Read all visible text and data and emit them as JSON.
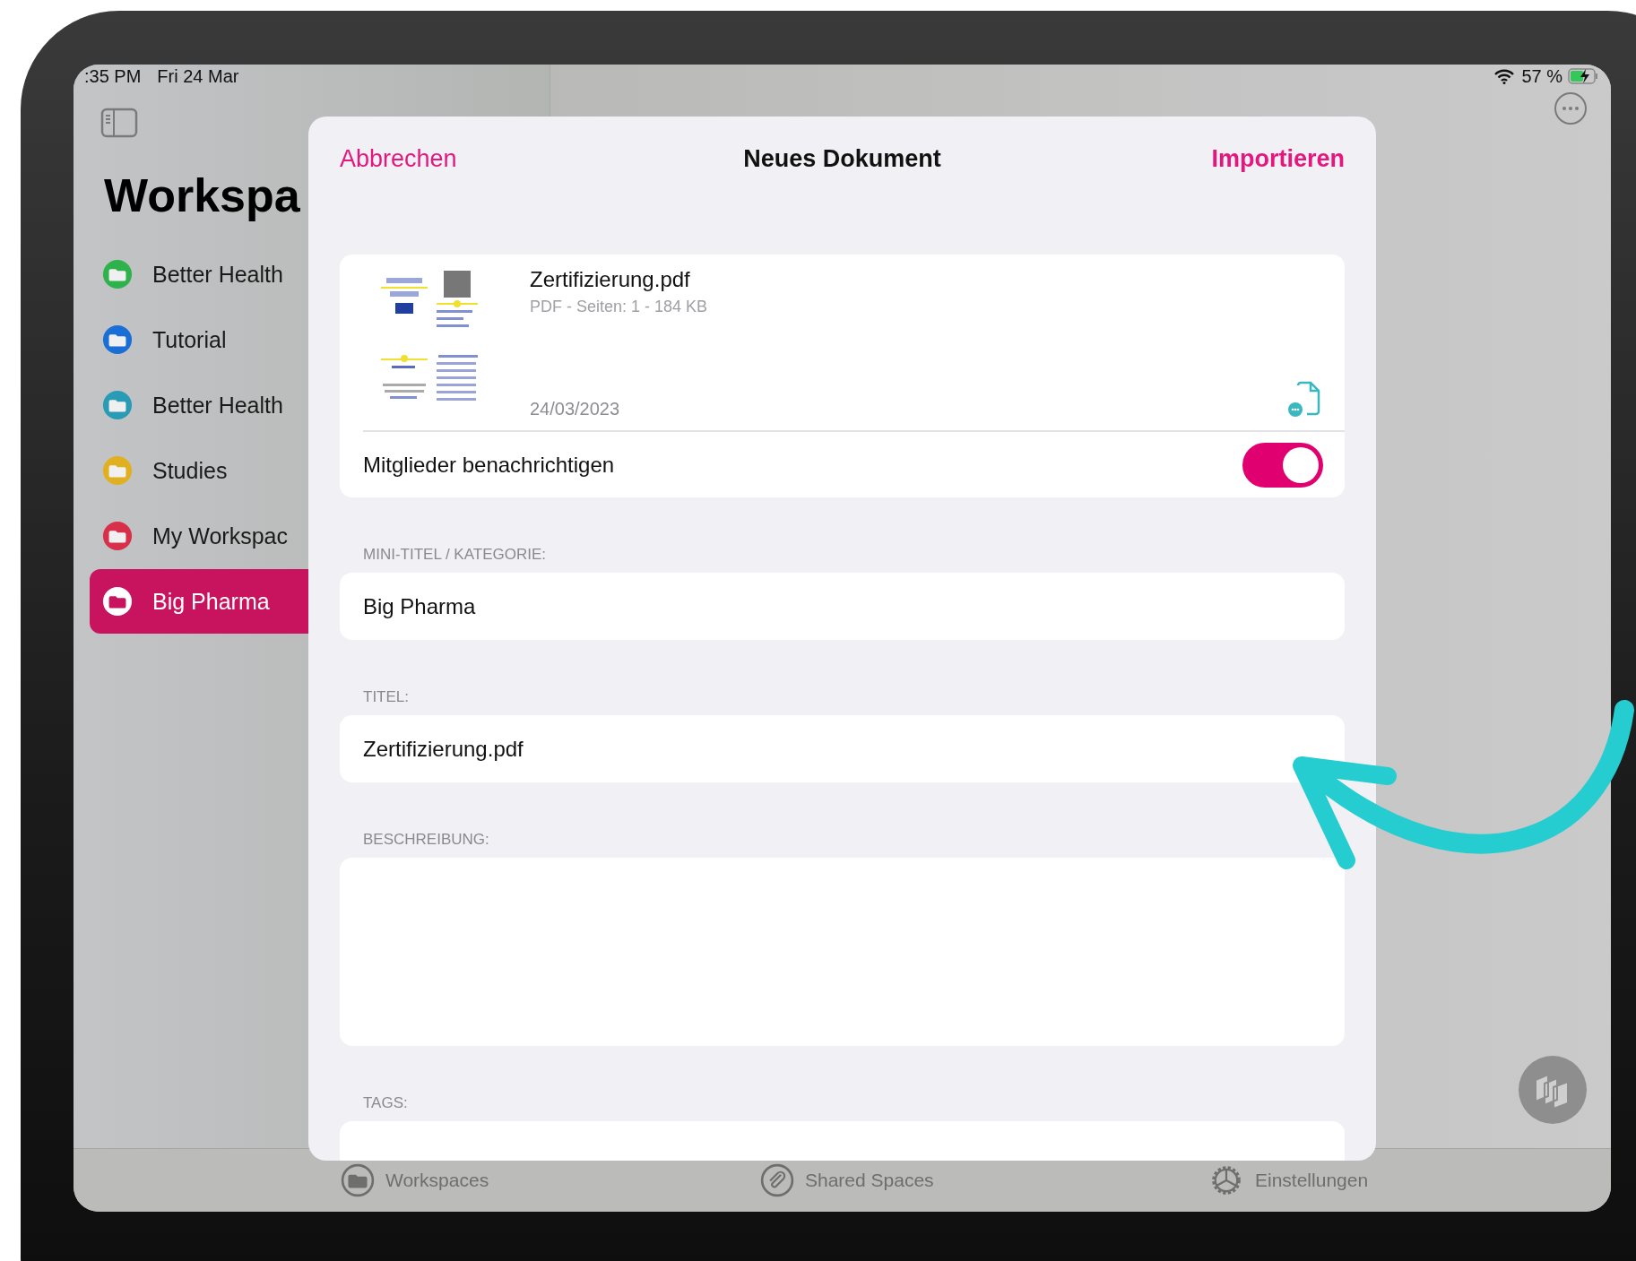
{
  "status_bar": {
    "time": ":35 PM",
    "date": "Fri 24 Mar",
    "battery": "57 %"
  },
  "sidebar": {
    "title": "Workspa",
    "items": [
      {
        "label": "Better Health",
        "color": "#2fb24c",
        "selected": false
      },
      {
        "label": "Tutorial",
        "color": "#1a6fd6",
        "selected": false
      },
      {
        "label": "Better Health",
        "color": "#2a9bb5",
        "selected": false
      },
      {
        "label": "Studies",
        "color": "#e0b020",
        "selected": false
      },
      {
        "label": "My Workspac",
        "color": "#d8304a",
        "selected": false
      },
      {
        "label": "Big Pharma",
        "color": "#c8145f",
        "selected": true
      }
    ]
  },
  "modal": {
    "cancel": "Abbrechen",
    "title": "Neues Dokument",
    "confirm": "Importieren",
    "document": {
      "name": "Zertifizierung.pdf",
      "meta": "PDF - Seiten: 1 - 184 KB",
      "date": "24/03/2023"
    },
    "notify": {
      "label": "Mitglieder benachrichtigen",
      "on": true
    },
    "fields": [
      {
        "label": "MINI-TITEL / KATEGORIE:",
        "value": "Big Pharma",
        "kind": "line"
      },
      {
        "label": "TITEL:",
        "value": "Zertifizierung.pdf",
        "kind": "line"
      },
      {
        "label": "BESCHREIBUNG:",
        "kind": "area"
      },
      {
        "label": "TAGS:",
        "kind": "line"
      }
    ]
  },
  "tab_bar": {
    "items": [
      {
        "label": "Workspaces",
        "kind": "folder"
      },
      {
        "label": "Shared Spaces",
        "kind": "clip"
      },
      {
        "label": "Einstellungen",
        "kind": "gear"
      }
    ]
  }
}
